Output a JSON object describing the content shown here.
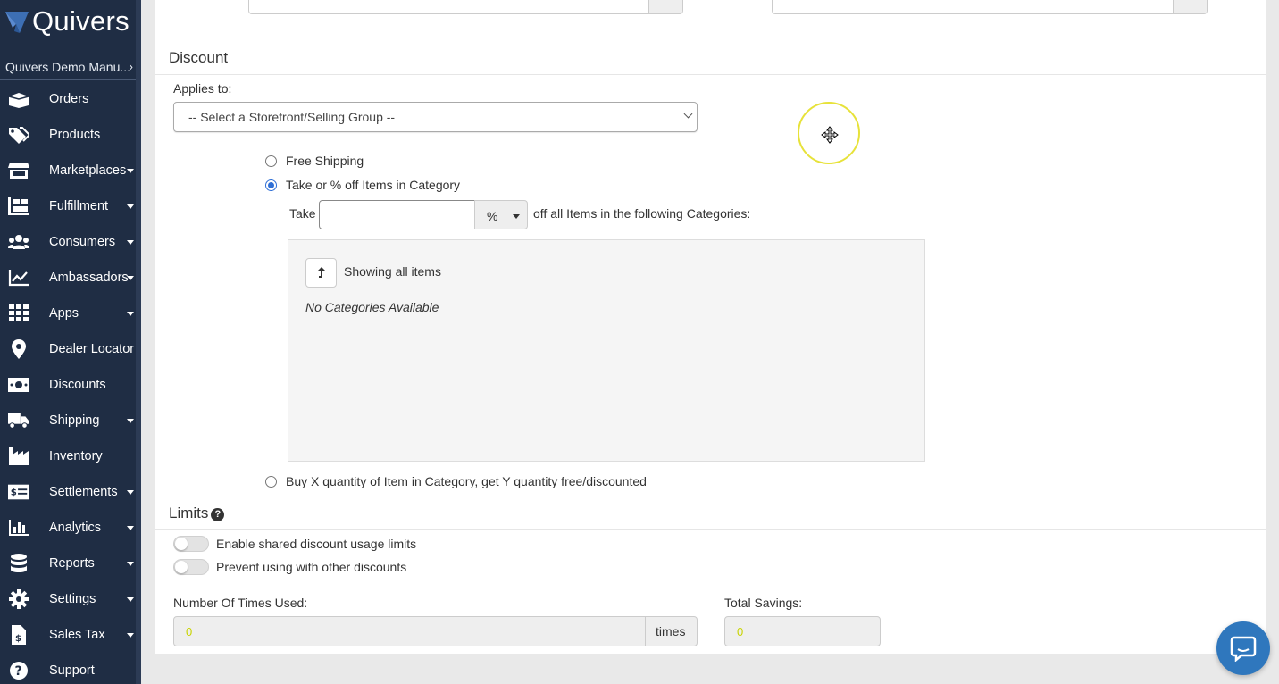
{
  "brand": {
    "name": "Quivers",
    "accent": "#1f2d44",
    "link_blue": "#2f6fd6"
  },
  "org_switcher": {
    "label": "Quivers Demo Manu..."
  },
  "nav": [
    {
      "label": "Orders",
      "icon": "box-icon",
      "dropdown": false
    },
    {
      "label": "Products",
      "icon": "tags-icon",
      "dropdown": false
    },
    {
      "label": "Marketplaces",
      "icon": "store-icon",
      "dropdown": true
    },
    {
      "label": "Fulfillment",
      "icon": "pallet-icon",
      "dropdown": true
    },
    {
      "label": "Consumers",
      "icon": "users-icon",
      "dropdown": true
    },
    {
      "label": "Ambassadors",
      "icon": "chart-line-icon",
      "dropdown": true
    },
    {
      "label": "Apps",
      "icon": "grid-icon",
      "dropdown": true
    },
    {
      "label": "Dealer Locator",
      "icon": "map-pin-icon",
      "dropdown": false
    },
    {
      "label": "Discounts",
      "icon": "money-bill-icon",
      "dropdown": false
    },
    {
      "label": "Shipping",
      "icon": "truck-icon",
      "dropdown": true
    },
    {
      "label": "Inventory",
      "icon": "industry-icon",
      "dropdown": false
    },
    {
      "label": "Settlements",
      "icon": "money-check-icon",
      "dropdown": true
    },
    {
      "label": "Analytics",
      "icon": "bar-chart-icon",
      "dropdown": true
    },
    {
      "label": "Reports",
      "icon": "database-icon",
      "dropdown": true
    },
    {
      "label": "Settings",
      "icon": "gear-icon",
      "dropdown": true
    },
    {
      "label": "Sales Tax",
      "icon": "file-dollar-icon",
      "dropdown": true
    },
    {
      "label": "Support",
      "icon": "question-circle-icon",
      "dropdown": false
    }
  ],
  "discount": {
    "title": "Discount",
    "applies_to_label": "Applies to:",
    "applies_to_value": "-- Select a Storefront/Selling Group --",
    "options": {
      "free_shipping": "Free Shipping",
      "take_pct": "Take or % off Items in Category",
      "buy_x": "Buy X quantity of Item in Category, get Y quantity free/discounted"
    },
    "selected_option": "take_pct",
    "take_label": "Take",
    "take_value": "",
    "unit_value": "%",
    "take_suffix": "off all Items in the following Categories:",
    "showing_text": "Showing all items",
    "no_categories": "No Categories Available"
  },
  "limits": {
    "title": "Limits",
    "shared_limits_label": "Enable shared discount usage limits",
    "shared_limits_on": false,
    "prevent_other_label": "Prevent using with other discounts",
    "prevent_other_on": false,
    "times_used_label": "Number Of Times Used:",
    "times_used_value": "0",
    "times_addon": "times",
    "total_savings_label": "Total Savings:",
    "total_savings_value": "0"
  }
}
